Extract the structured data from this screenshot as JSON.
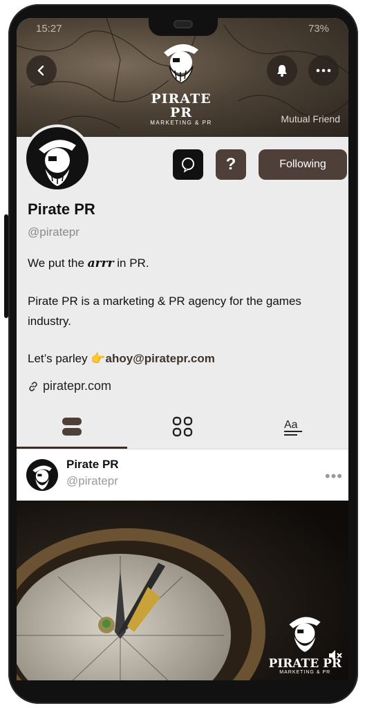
{
  "status_bar": {
    "time": "15:27",
    "battery": "73%"
  },
  "header": {
    "logo_title": "PIRATE PR",
    "logo_subtitle": "MARKETING & PR",
    "mutual": "Mutual Friend"
  },
  "profile": {
    "name": "Pirate PR",
    "handle": "@piratepr",
    "bio_line1_pre": "We put the ",
    "bio_line1_word": "arrr",
    "bio_line1_post": " in PR.",
    "bio_line2": "Pirate PR is a marketing & PR agency for the games industry.",
    "bio_line3_pre": "Let’s parley ",
    "bio_emoji": "👉",
    "bio_email": "ahoy@piratepr.com",
    "website": "piratepr.com",
    "follow_label": "Following",
    "question_label": "?"
  },
  "post": {
    "name": "Pirate PR",
    "handle": "@piratepr",
    "more": "•••",
    "watermark_title": "PIRATE PR",
    "watermark_sub": "MARKETING & PR"
  },
  "icons": [
    "back-icon",
    "bell-icon",
    "more-icon",
    "chat-icon",
    "link-icon",
    "posts-tab-icon",
    "grid-tab-icon",
    "text-tab-icon",
    "mute-icon"
  ],
  "colors": {
    "brand_brown": "#4e4038",
    "background": "#ececec"
  }
}
